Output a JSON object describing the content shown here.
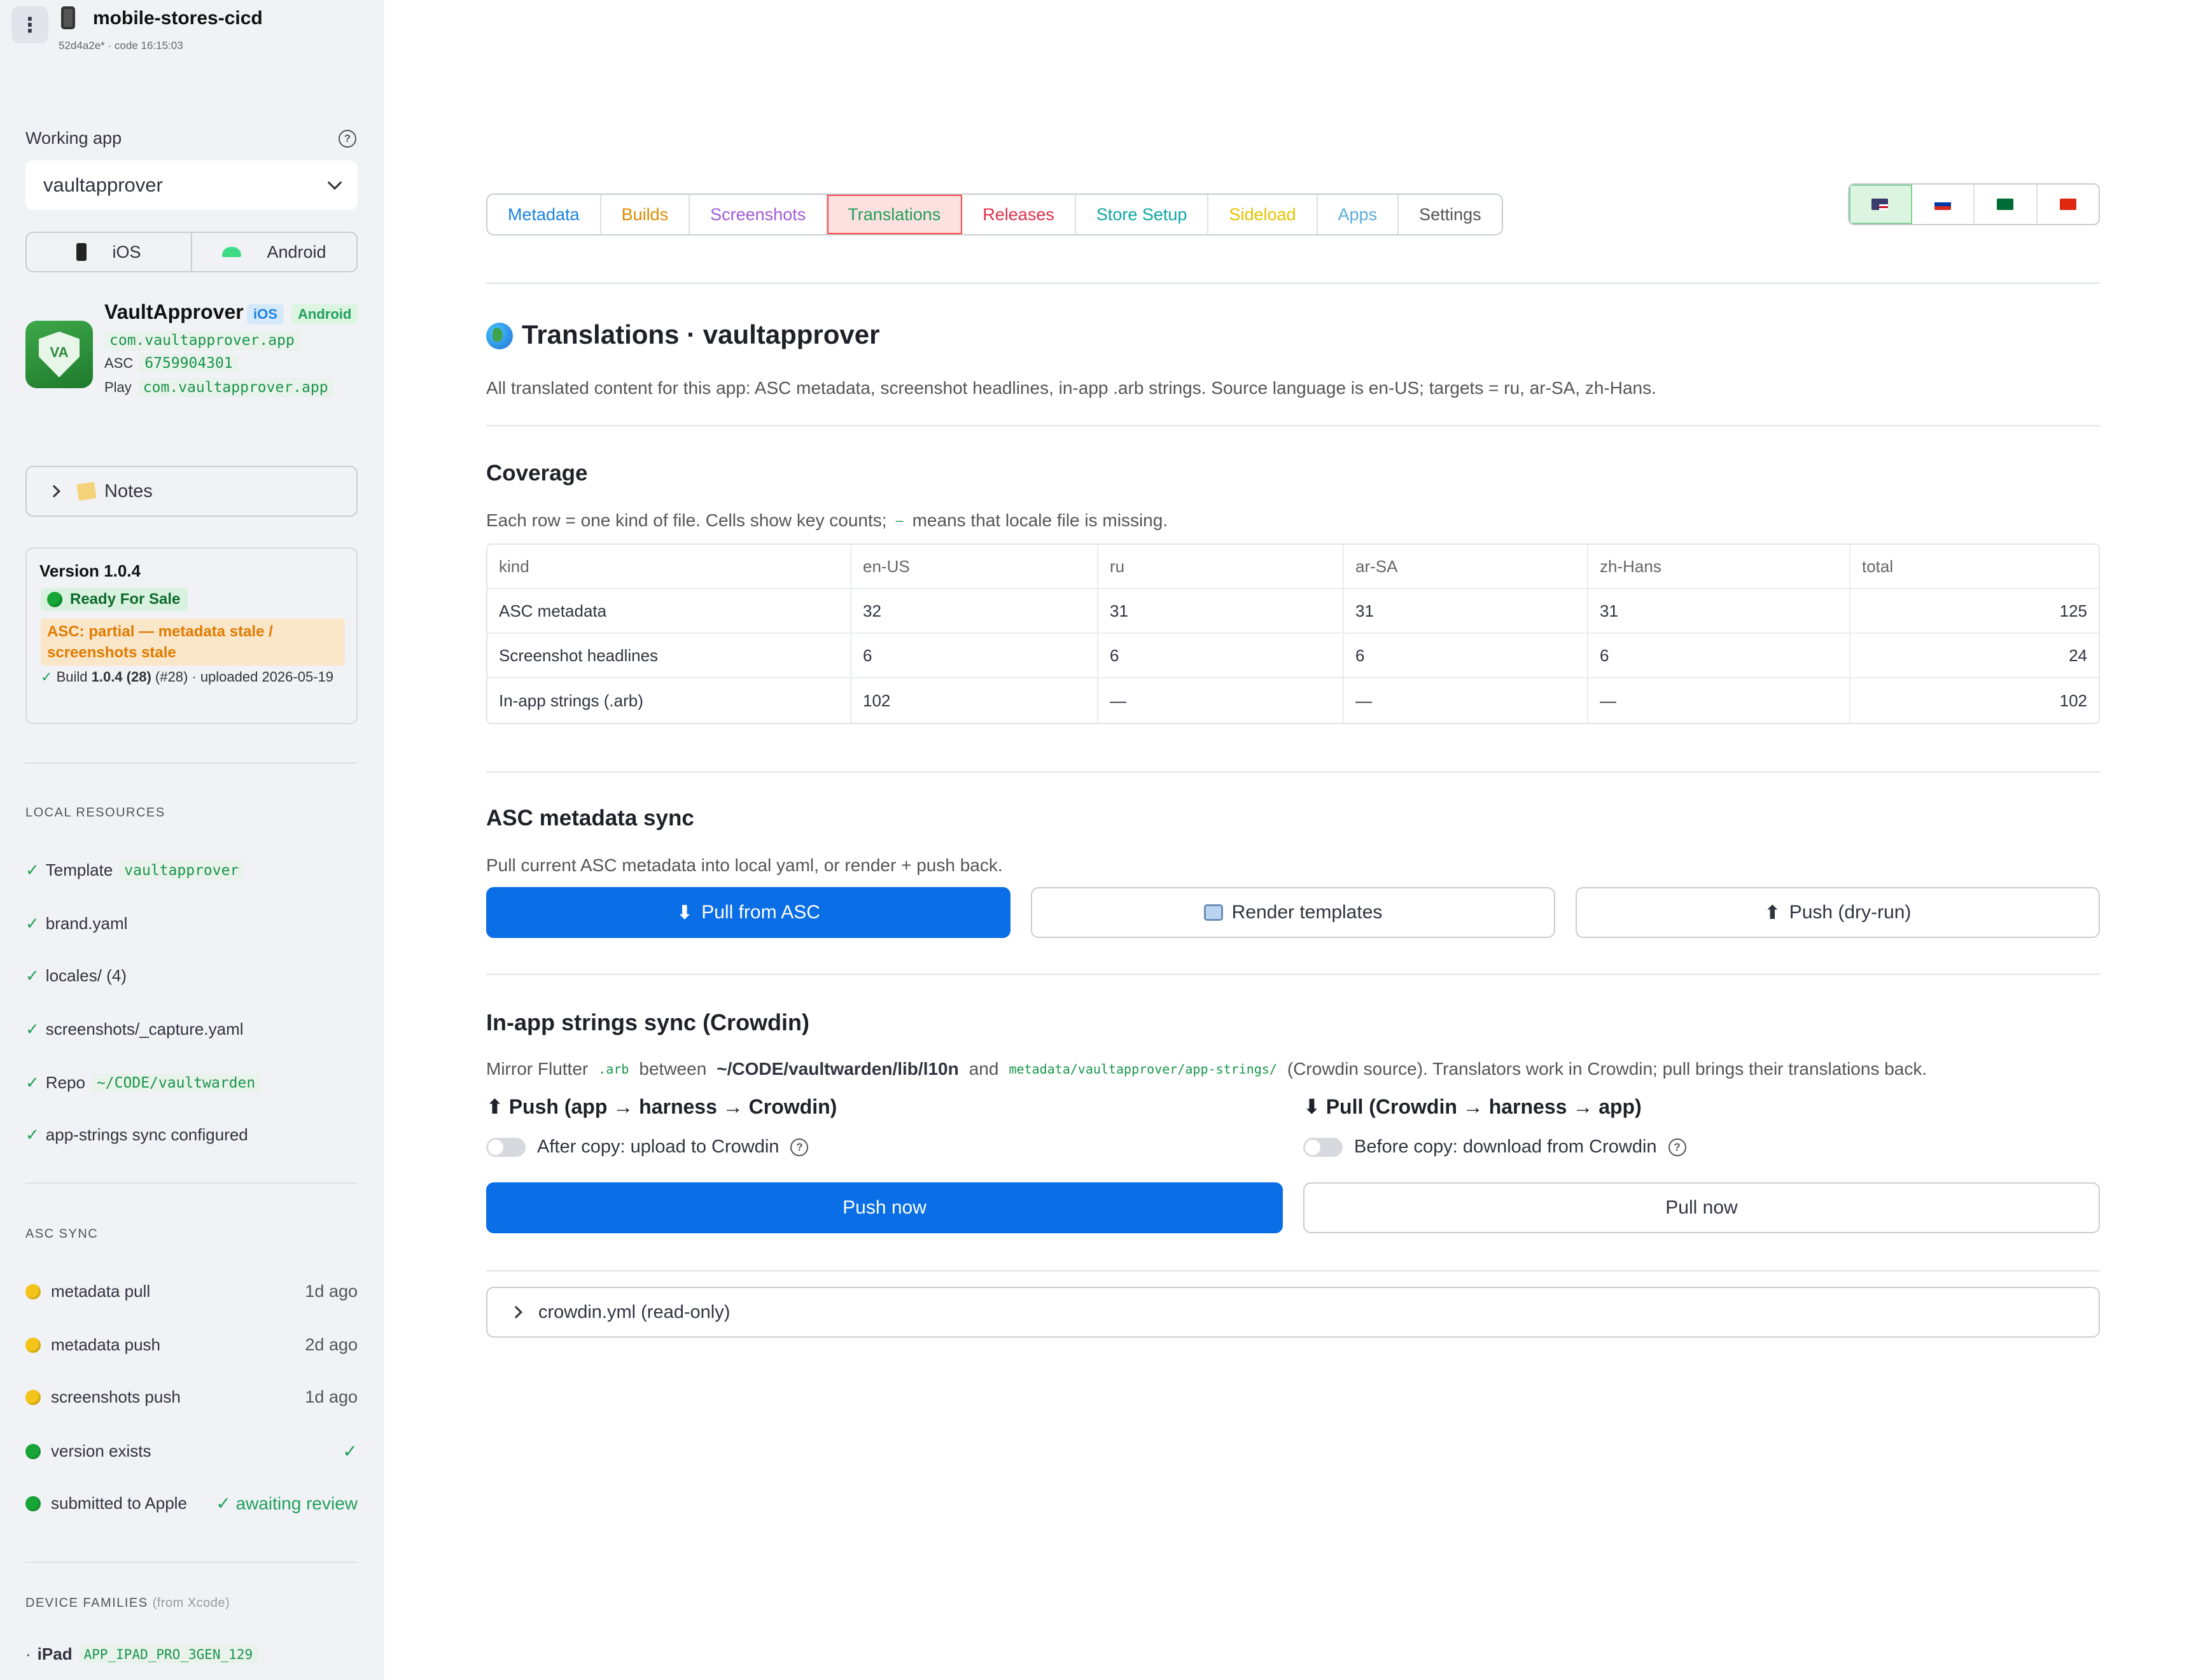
{
  "app": {
    "title": "mobile-stores-cicd",
    "subtitle": "52d4a2e* · code 16:15:03"
  },
  "sidebar": {
    "working_app_label": "Working app",
    "working_app_value": "vaultapprover",
    "platforms": [
      "iOS",
      "Android"
    ],
    "app_card": {
      "name": "VaultApprover",
      "badge_ios": "iOS",
      "badge_android": "Android",
      "bundle": "com.vaultapprover.app",
      "asc_label": "ASC",
      "asc_id": "6759904301",
      "play_label": "Play",
      "play_id": "com.vaultapprover.app",
      "icon_text": "VA"
    },
    "notes_label": "Notes",
    "version": {
      "title": "Version 1.0.4",
      "status": "Ready For Sale",
      "warning": "ASC: partial — metadata stale / screenshots stale",
      "build_prefix": "Build",
      "build": "1.0.4 (28)",
      "build_suffix": "(#28) · uploaded 2026-05-19"
    },
    "local_resources_title": "LOCAL RESOURCES",
    "resources": [
      {
        "label": "Template",
        "code": "vaultapprover"
      },
      {
        "label": "brand.yaml",
        "code": ""
      },
      {
        "label": "locales/ (4)",
        "code": ""
      },
      {
        "label": "screenshots/_capture.yaml",
        "code": ""
      },
      {
        "label": "Repo",
        "code": "~/CODE/vaultwarden"
      },
      {
        "label": "app-strings sync configured",
        "code": ""
      }
    ],
    "asc_sync_title": "ASC SYNC",
    "asc_sync": [
      {
        "label": "metadata pull",
        "status": "1d ago",
        "color": "#f4c419"
      },
      {
        "label": "metadata push",
        "status": "2d ago",
        "color": "#f4c419"
      },
      {
        "label": "screenshots push",
        "status": "1d ago",
        "color": "#f4c419"
      },
      {
        "label": "version exists",
        "status": "✓",
        "color": "#16a536"
      },
      {
        "label": "submitted to Apple",
        "status": "✓ awaiting review",
        "color": "#16a536"
      }
    ],
    "device_families_title": "DEVICE FAMILIES",
    "device_families_note": "(from Xcode)",
    "device_families": [
      {
        "label": "iPad",
        "code": "APP_IPAD_PRO_3GEN_129"
      }
    ]
  },
  "tabs": [
    {
      "label": "Metadata",
      "color": "#1c83e1"
    },
    {
      "label": "Builds",
      "color": "#e08a00"
    },
    {
      "label": "Screenshots",
      "color": "#a05bd6"
    },
    {
      "label": "Translations",
      "color": "#21a05a",
      "active": true
    },
    {
      "label": "Releases",
      "color": "#e0304b"
    },
    {
      "label": "Store Setup",
      "color": "#0fa6a6"
    },
    {
      "label": "Sideload",
      "color": "#e6c200"
    },
    {
      "label": "Apps",
      "color": "#5aaedc"
    },
    {
      "label": "Settings",
      "color": "#555555"
    }
  ],
  "flags": [
    {
      "name": "us-flag-icon",
      "active": true
    },
    {
      "name": "ru-flag-icon"
    },
    {
      "name": "sa-flag-icon"
    },
    {
      "name": "cn-flag-icon"
    }
  ],
  "page": {
    "title": "Translations · vaultapprover",
    "description": "All translated content for this app: ASC metadata, screenshot headlines, in-app .arb strings. Source language is en-US; targets = ru, ar-SA, zh-Hans."
  },
  "coverage": {
    "title": "Coverage",
    "desc_before": "Each row = one kind of file. Cells show key counts;",
    "desc_code": "—",
    "desc_after": "means that locale file is missing.",
    "headers": [
      "kind",
      "en-US",
      "ru",
      "ar-SA",
      "zh-Hans",
      "total"
    ],
    "rows": [
      [
        "ASC metadata",
        "32",
        "31",
        "31",
        "31",
        "125"
      ],
      [
        "Screenshot headlines",
        "6",
        "6",
        "6",
        "6",
        "24"
      ],
      [
        "In-app strings (.arb)",
        "102",
        "—",
        "—",
        "—",
        "102"
      ]
    ]
  },
  "asc_sync_section": {
    "title": "ASC metadata sync",
    "desc": "Pull current ASC metadata into local yaml, or render + push back.",
    "pull": "Pull from ASC",
    "render": "Render templates",
    "push": "Push (dry-run)"
  },
  "crowdin": {
    "title": "In-app strings sync (Crowdin)",
    "desc_mirror": "Mirror Flutter",
    "desc_arb": ".arb",
    "desc_between": "between",
    "desc_path": "~/CODE/vaultwarden/lib/l10n",
    "desc_and": "and",
    "desc_meta": "metadata/vaultapprover/app-strings/",
    "desc_rest": "(Crowdin source). Translators work in Crowdin; pull brings their translations back.",
    "push_title": "Push (app → harness → Crowdin)",
    "pull_title": "Pull (Crowdin → harness → app)",
    "push_toggle": "After copy: upload to Crowdin",
    "pull_toggle": "Before copy: download from Crowdin",
    "push_button": "Push now",
    "pull_button": "Pull now",
    "yaml_label": "crowdin.yml (read-only)"
  }
}
